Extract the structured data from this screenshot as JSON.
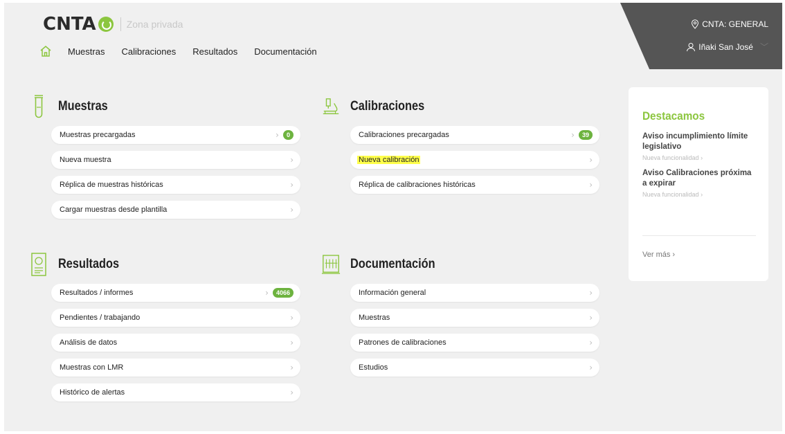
{
  "brand": {
    "logo_text": "CNTA",
    "subtitle": "Zona privada",
    "accent": "#8cc63f"
  },
  "nav": {
    "items": [
      "Muestras",
      "Calibraciones",
      "Resultados",
      "Documentación"
    ]
  },
  "user": {
    "location": "CNTA: GENERAL",
    "name": "Iñaki San José"
  },
  "sections": {
    "muestras": {
      "title": "Muestras",
      "items": [
        {
          "label": "Muestras precargadas",
          "badge": "0"
        },
        {
          "label": "Nueva muestra"
        },
        {
          "label": "Réplica de muestras históricas"
        },
        {
          "label": "Cargar muestras desde plantilla"
        }
      ]
    },
    "calibraciones": {
      "title": "Calibraciones",
      "items": [
        {
          "label": "Calibraciones precargadas",
          "badge": "39"
        },
        {
          "label": "Nueva calibración",
          "highlight": "#ffff4a"
        },
        {
          "label": "Réplica de calibraciones históricas"
        }
      ]
    },
    "resultados": {
      "title": "Resultados",
      "items": [
        {
          "label": "Resultados / informes",
          "badge": "4066"
        },
        {
          "label": "Pendientes / trabajando"
        },
        {
          "label": "Análisis de datos"
        },
        {
          "label": "Muestras con LMR"
        },
        {
          "label": "Histórico de alertas"
        }
      ]
    },
    "documentacion": {
      "title": "Documentación",
      "items": [
        {
          "label": "Información general"
        },
        {
          "label": "Muestras"
        },
        {
          "label": "Patrones de calibraciones"
        },
        {
          "label": "Estudios"
        }
      ]
    }
  },
  "highlights": {
    "title": "Destacamos",
    "news": [
      {
        "title": "Aviso incumplimiento límite legislativo",
        "sub": "Nueva funcionalidad"
      },
      {
        "title": "Aviso Calibraciones próxima a expirar",
        "sub": "Nueva funcionalidad"
      }
    ],
    "more_label": "Ver más"
  }
}
